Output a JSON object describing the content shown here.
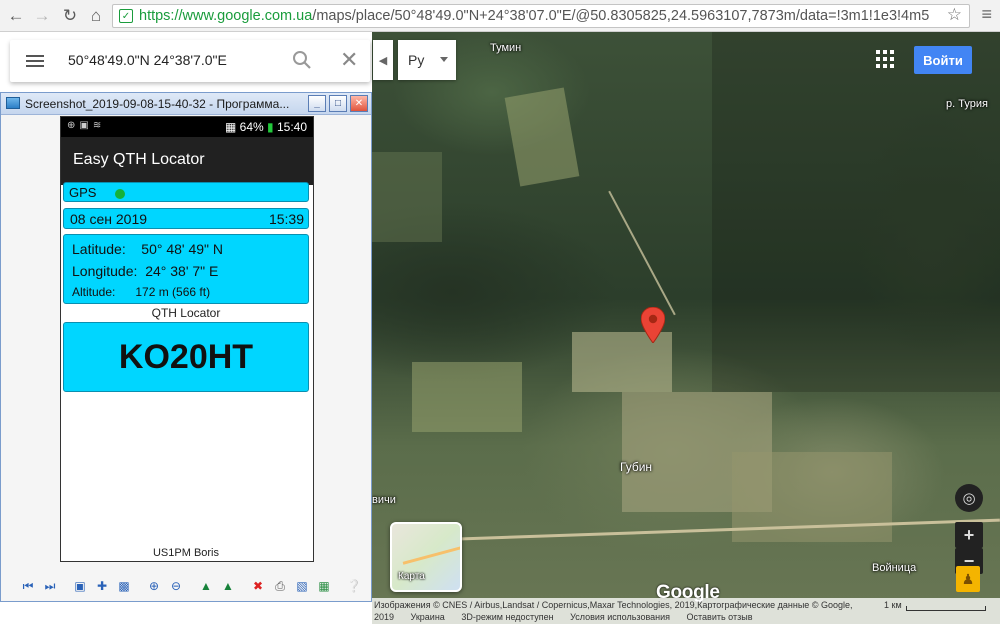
{
  "browser": {
    "url_scheme": "https://",
    "url_host": "www.google.com.ua",
    "url_rest": "/maps/place/50°48'49.0\"N+24°38'07.0\"E/@50.8305825,24.5963107,7873m/data=!3m1!1e3!4m5"
  },
  "search": {
    "value": "50°48'49.0\"N 24°38'7.0\"E"
  },
  "map": {
    "language_button": "Ру",
    "signin_label": "Войти",
    "layer_label": "Карта",
    "google_logo": "Google",
    "labels": {
      "tumyn": "Тумин",
      "river": "р. Турия",
      "gubyn": "Губин",
      "vychi": "вичи",
      "voinitsa": "Войница"
    },
    "attribution_line1": "Изображения © CNES / Airbus,Landsat / Copernicus,Maxar Technologies, 2019,Картографические данные © Google,",
    "attribution_year": "2019",
    "attribution_links": [
      "Украина",
      "3D-режим недоступен",
      "Условия использования",
      "Оставить отзыв"
    ],
    "scale_label": "1 км",
    "pin_color": "#ea4335"
  },
  "viewer": {
    "title": "Screenshot_2019-09-08-15-40-32 - Программа..."
  },
  "phone": {
    "status": {
      "battery": "64%",
      "time": "15:40"
    },
    "app_title": "Easy QTH Locator",
    "gps_label": "GPS",
    "date": "08 сен 2019",
    "time": "15:39",
    "latitude_label": "Latitude:",
    "latitude_value": "50° 48' 49\" N",
    "longitude_label": "Longitude:",
    "longitude_value": "24° 38' 7\" E",
    "altitude_label": "Altitude:",
    "altitude_value": "172 m (566 ft)",
    "qth_label": "QTH Locator",
    "locator": "KO20HT",
    "author": "US1PM Boris",
    "accent_color": "#00d6ff"
  }
}
